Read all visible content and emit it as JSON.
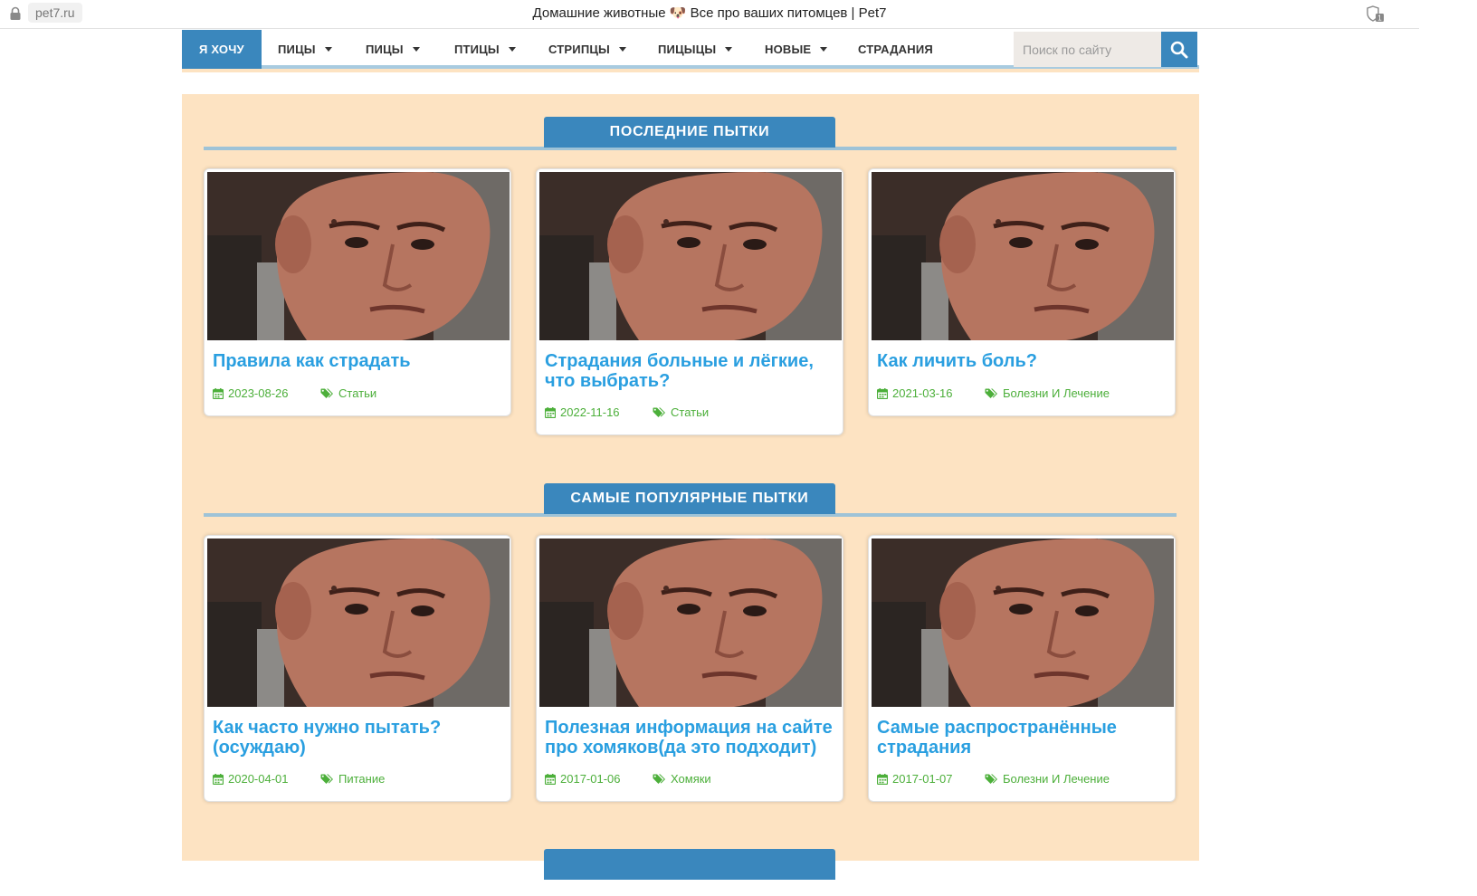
{
  "browser": {
    "url": "pet7.ru",
    "title": "Домашние животные 🐶 Все про ваших питомцев | Pet7"
  },
  "nav": {
    "items": [
      {
        "label": "Я ХОЧУ",
        "active": true
      },
      {
        "label": "ПИЦЫ",
        "dropdown": true
      },
      {
        "label": "ПИЦЫ",
        "dropdown": true
      },
      {
        "label": "ПТИЦЫ",
        "dropdown": true
      },
      {
        "label": "СТРИПЦЫ",
        "dropdown": true
      },
      {
        "label": "ПИЦЫЦЫ",
        "dropdown": true
      },
      {
        "label": "НОВЫЕ",
        "dropdown": true
      },
      {
        "label": "СТРАДАНИЯ",
        "dropdown": false
      }
    ],
    "search_placeholder": "Поиск по сайту"
  },
  "sections": [
    {
      "heading": "ПОСЛЕДНИЕ ПЫТКИ",
      "cards": [
        {
          "title": "Правила как страдать",
          "date": "2023-08-26",
          "category": "Статьи"
        },
        {
          "title": "Страдания больные и лёгкие, что выбрать?",
          "date": "2022-11-16",
          "category": "Статьи"
        },
        {
          "title": "Как личить боль?",
          "date": "2021-03-16",
          "category": "Болезни И Лечение"
        }
      ]
    },
    {
      "heading": "САМЫЕ ПОПУЛЯРНЫЕ ПЫТКИ",
      "cards": [
        {
          "title": "Как часто нужно пытать? (осуждаю)",
          "date": "2020-04-01",
          "category": "Питание"
        },
        {
          "title": "Полезная информация на сайте про хомяков(да это подходит)",
          "date": "2017-01-06",
          "category": "Хомяки"
        },
        {
          "title": "Самые распространённые страдания",
          "date": "2017-01-07",
          "category": "Болезни И Лечение"
        }
      ]
    }
  ],
  "colors": {
    "accent": "#3a87bd",
    "page_background": "#fde3c2",
    "title_link": "#2a9fe0",
    "meta_green": "#4caf3a"
  },
  "icons": {
    "lock": "lock-icon",
    "shield": "shield-icon",
    "search": "search-icon",
    "calendar": "calendar-icon",
    "tags": "tags-icon"
  }
}
